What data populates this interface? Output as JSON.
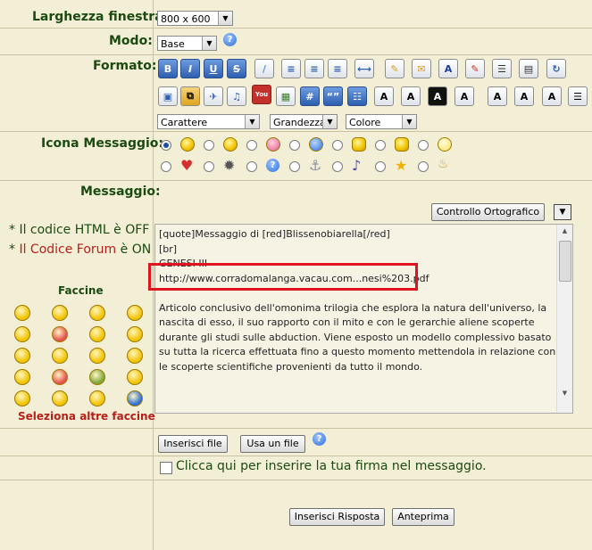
{
  "labels": {
    "window_width": "Larghezza finestra:",
    "mode": "Modo:",
    "format": "Formato:",
    "icon": "Icona Messaggio:",
    "message": "Messaggio:"
  },
  "selects": {
    "window_width": "800 x 600",
    "mode": "Base",
    "font": "Carattere",
    "size": "Grandezza",
    "color": "Colore"
  },
  "toolbar": {
    "bold": "B",
    "italic": "I",
    "underline": "U",
    "strike": "S",
    "hash": "#",
    "quote": "“”"
  },
  "notes": {
    "html_prefix": "* Il codice HTML è ",
    "html_state": "OFF",
    "forum_prefix": "* ",
    "forum_label": "Il Codice Forum",
    "forum_mid": " è ",
    "forum_state": "ON"
  },
  "smileys": {
    "title": "Faccine",
    "more_link": "Seleziona altre faccine"
  },
  "spellcheck_button": "Controllo Ortografico",
  "message_text": "[quote]Messaggio di [red]Blissenobiarella[/red]\n[br]\nGENESI III\nhttp://www.corradomalanga.vacau.com...nesi%203.pdf\n\nArticolo conclusivo dell'omonima trilogia che esplora la natura dell'universo, la nascita di esso, il suo rapporto con il mito e con le gerarchie aliene scoperte durante gli studi sulle abduction. Viene esposto un modello complessivo basato su tutta la ricerca effettuata fino a questo momento mettendola in relazione con le scoperte scientifiche provenienti da tutto il mondo.",
  "file_buttons": {
    "insert": "Inserisci file",
    "use": "Usa un file"
  },
  "signature_label": "Clicca qui per inserire la tua firma nel messaggio.",
  "submit_buttons": {
    "reply": "Inserisci Risposta",
    "preview": "Anteprima"
  },
  "colors": {
    "label_green": "#1b4a12",
    "highlight_red": "#e0141e",
    "forum_red": "#b5201a"
  }
}
